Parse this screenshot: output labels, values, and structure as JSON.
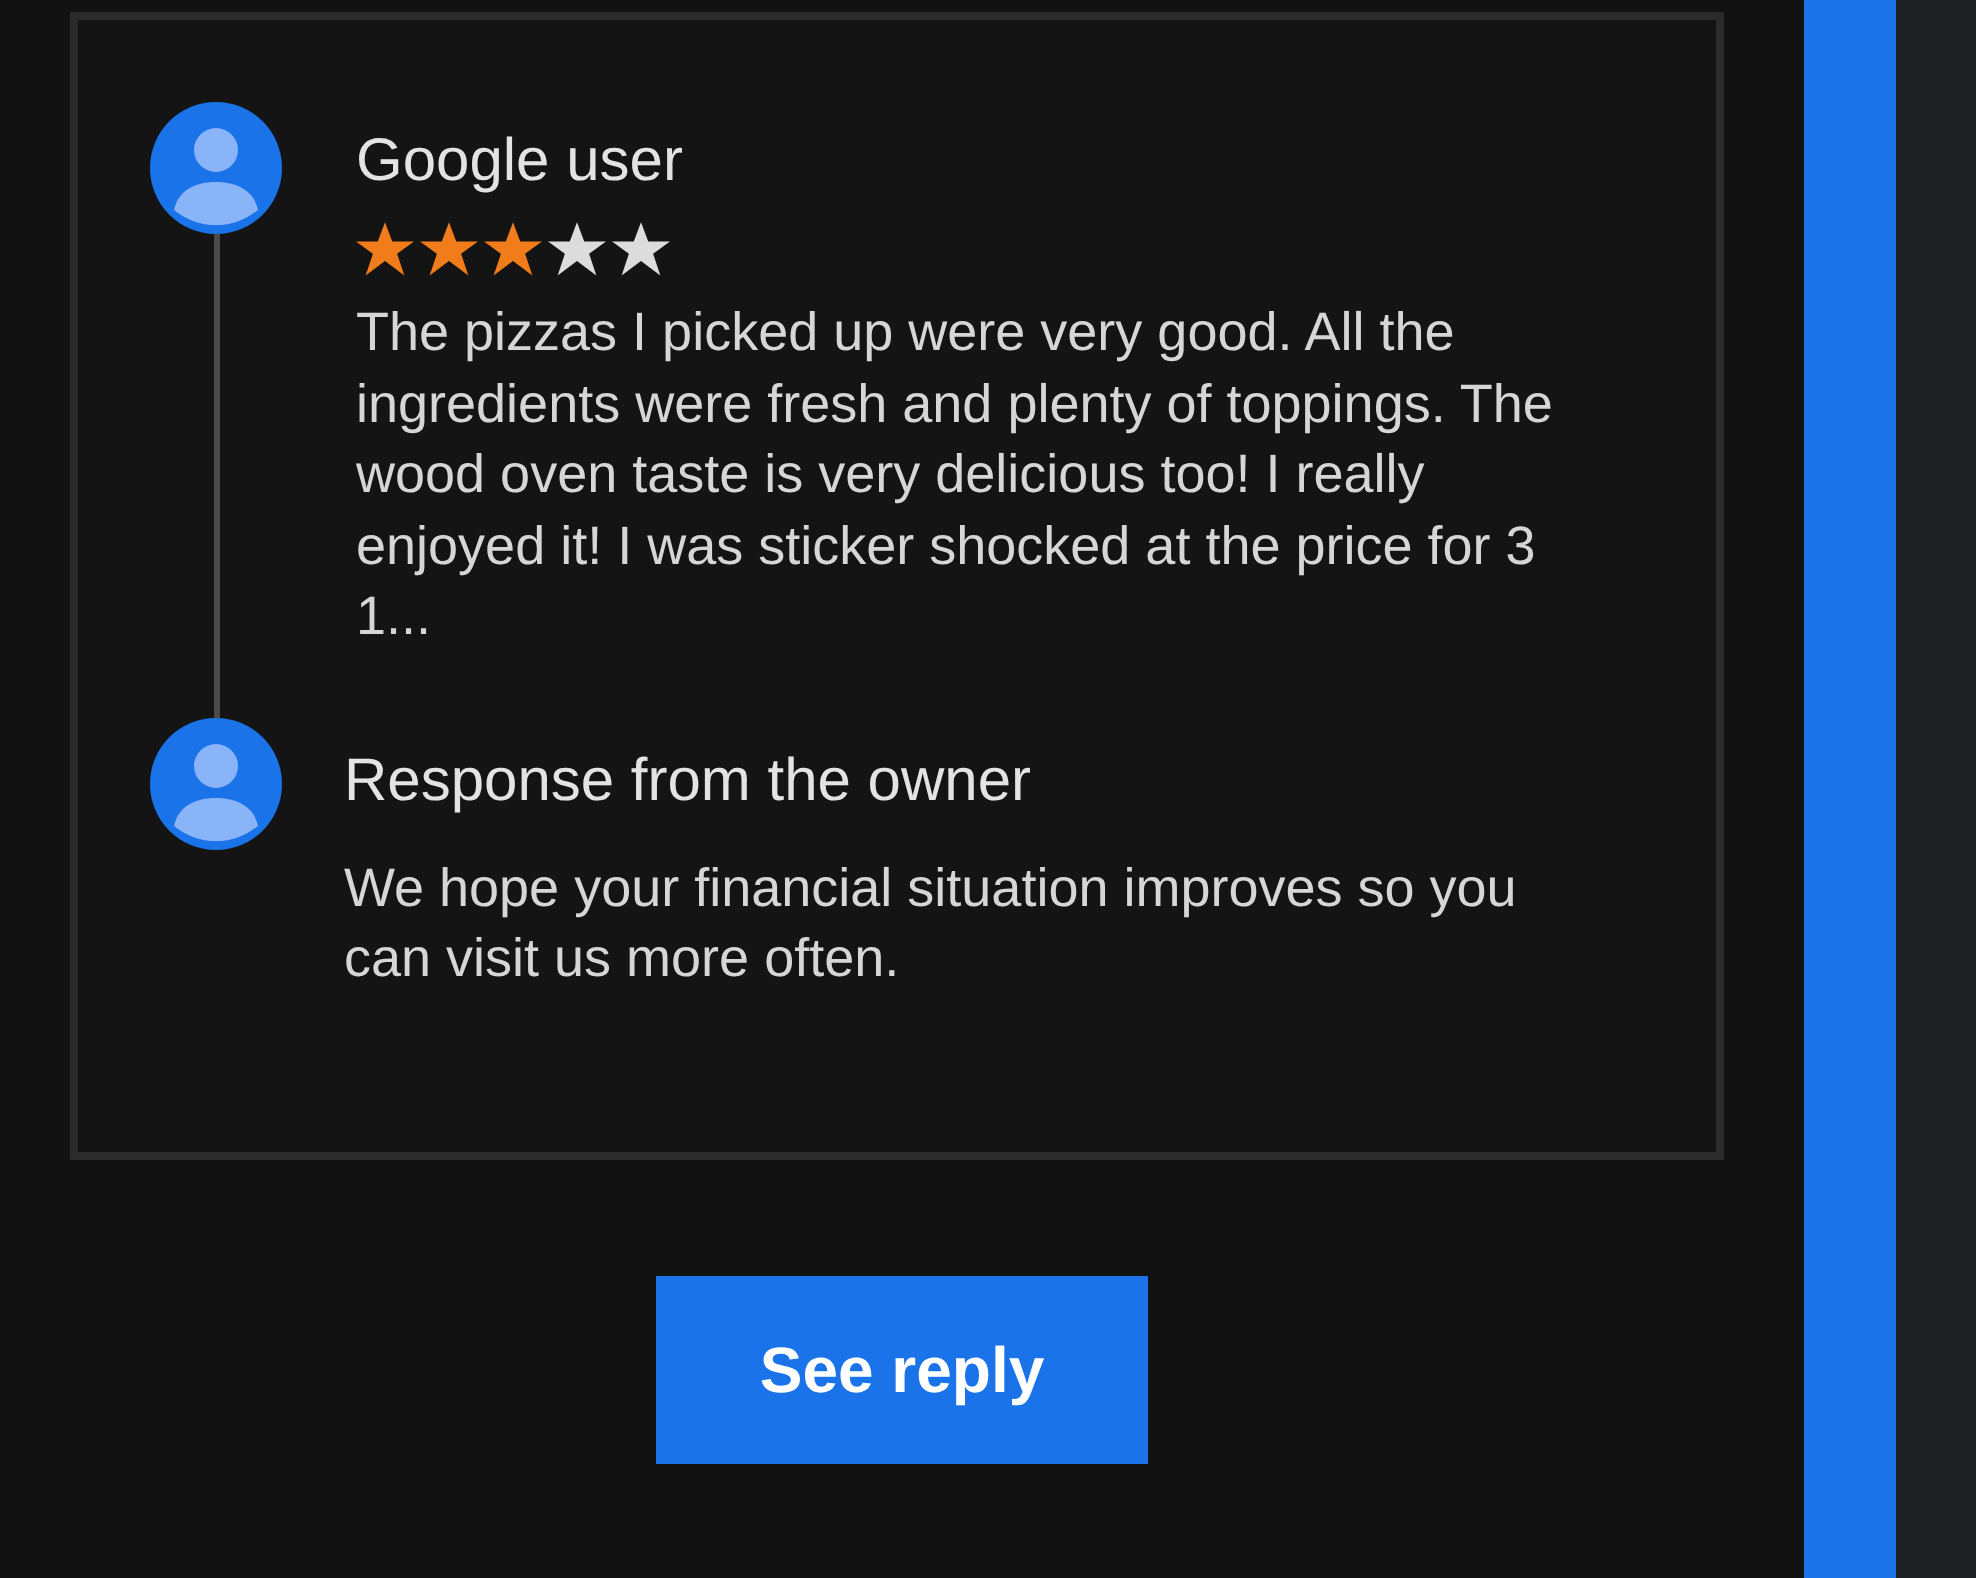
{
  "review": {
    "author": "Google user",
    "stars": 3,
    "text": "The pizzas I picked up were very good. All the ingredients were fresh and plenty of toppings. The wood oven taste is very delicious too! I really enjoyed it! I was sticker shocked at the price for 3 1..."
  },
  "owner_response": {
    "title": "Response from the owner",
    "text": "We hope your financial situation improves so you can visit us more often."
  },
  "button": {
    "label": "See reply"
  }
}
